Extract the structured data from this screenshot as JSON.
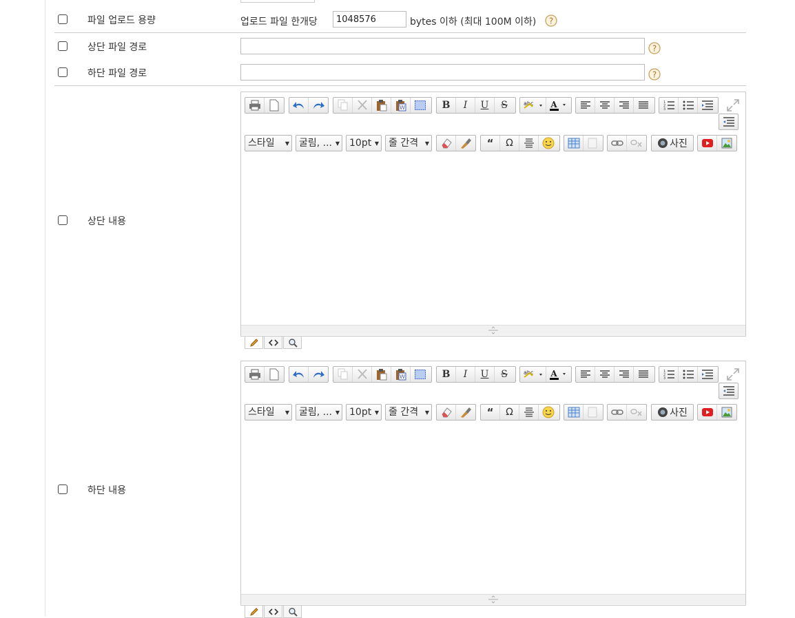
{
  "rows": {
    "upload_size": {
      "label": "파일 업로드 용량",
      "prefix": "업로드 파일 한개당",
      "value": "1048576",
      "suffix": "bytes 이하 (최대 100M 이하)"
    },
    "header_path": {
      "label": "상단 파일 경로",
      "value": ""
    },
    "footer_path": {
      "label": "하단 파일 경로",
      "value": ""
    },
    "header_content": {
      "label": "상단 내용"
    },
    "footer_content": {
      "label": "하단 내용"
    }
  },
  "editor": {
    "style_select": "스타일",
    "font_select": "굴림, ...",
    "size_select": "10pt",
    "lineheight_select": "줄 간격",
    "photo_label": "사진",
    "font_color_label": "A",
    "bold": "B",
    "italic": "I",
    "underline": "U",
    "strike": "S",
    "quote": "“",
    "omega": "Ω"
  },
  "colors": {
    "help": "#c8a060",
    "youtube": "#e02020"
  }
}
